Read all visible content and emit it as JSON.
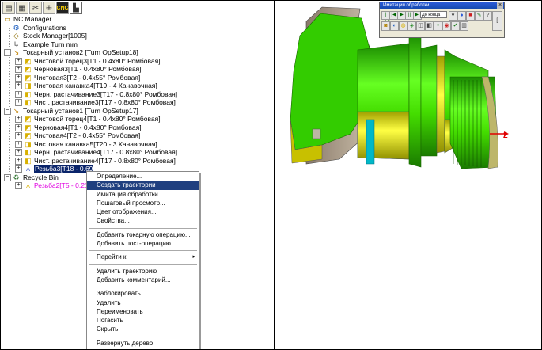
{
  "toolbar": {
    "icons": [
      "nc-manager-icon",
      "properties-icon",
      "tools-icon",
      "origin-icon",
      "cnc-icon",
      "turn-icon"
    ],
    "cnc_label": "CNC"
  },
  "tree": {
    "root": "NC Manager",
    "configurations": "Configurations",
    "stock_manager": "Stock Manager[1005]",
    "example": "Example Turn mm",
    "setup2": {
      "label": "Токарный установ2 [Turn OpSetup18]",
      "items": [
        "Чистовой торец3[T1 - 0.4x80° Ромбовая]",
        "Черновая3[T1 - 0.4x80° Ромбовая]",
        "Чистовая3[T2 - 0.4x55° Ромбовая]",
        "Чистовая канавка4[T19 - 4 Канавочная]",
        "Черн. растачивание3[T17 - 0.8x80° Ромбовая]",
        "Чист. растачивание3[T17 - 0.8x80° Ромбовая]"
      ]
    },
    "setup1": {
      "label": "Токарный установ1 [Turn OpSetup17]",
      "items": [
        "Чистовой торец4[T1 - 0.4x80° Ромбовая]",
        "Черновая4[T1 - 0.4x80° Ромбовая]",
        "Чистовая4[T2 - 0.4x55° Ромбовая]",
        "Чистовая канавка5[T20 - 3 Канавочная]",
        "Черн. растачивание4[T17 - 0.8x80° Ромбовая]",
        "Чист. растачивание4[T17 - 0.8x80° Ромбовая]"
      ],
      "selected": "Резьба3[T18 - 0.69"
    },
    "recycle_bin": "Recycle Bin",
    "recycle_item": "Резьба2[T5 - 0.21x"
  },
  "context_menu": {
    "items": [
      {
        "label": "Определение...",
        "active": false
      },
      {
        "label": "Создать траектории",
        "active": true
      },
      {
        "label": "Имитация обработки...",
        "active": false
      },
      {
        "label": "Пошаговый просмотр...",
        "active": false
      },
      {
        "label": "Цвет отображения...",
        "active": false
      },
      {
        "label": "Свойства...",
        "active": false
      },
      {
        "sep": true
      },
      {
        "label": "Добавить токарную операцию...",
        "active": false
      },
      {
        "label": "Добавить пост-операцию...",
        "active": false
      },
      {
        "sep": true
      },
      {
        "label": "Перейти к",
        "active": false,
        "submenu": true
      },
      {
        "sep": true
      },
      {
        "label": "Удалить траекторию",
        "active": false
      },
      {
        "label": "Добавить комментарий...",
        "active": false
      },
      {
        "sep": true
      },
      {
        "label": "Заблокировать",
        "active": false
      },
      {
        "label": "Удалить",
        "active": false
      },
      {
        "label": "Переименовать",
        "active": false
      },
      {
        "label": "Погасить",
        "active": false
      },
      {
        "label": "Скрыть",
        "active": false
      },
      {
        "sep": true
      },
      {
        "label": "Развернуть дерево",
        "active": false
      }
    ],
    "submenu_arrow": "▸"
  },
  "simulation": {
    "title": "Имитация обработки",
    "close": "×",
    "mode_select": "До конца",
    "buttons_row1": [
      "|◀◀",
      "|◀",
      "▶",
      "||",
      "▶|"
    ],
    "buttons_row2": [
      "a",
      "b",
      "c",
      "d",
      "e",
      "f",
      "g",
      "h",
      "i",
      "j"
    ]
  },
  "viewport": {
    "axis_label": "Z"
  },
  "colors": {
    "part_green": "#33cc00",
    "part_yellow": "#e0e000",
    "part_cyan": "#00b8c8",
    "part_gray": "#a89a88",
    "axis_red": "#e00000",
    "highlight": "#0a246a"
  }
}
